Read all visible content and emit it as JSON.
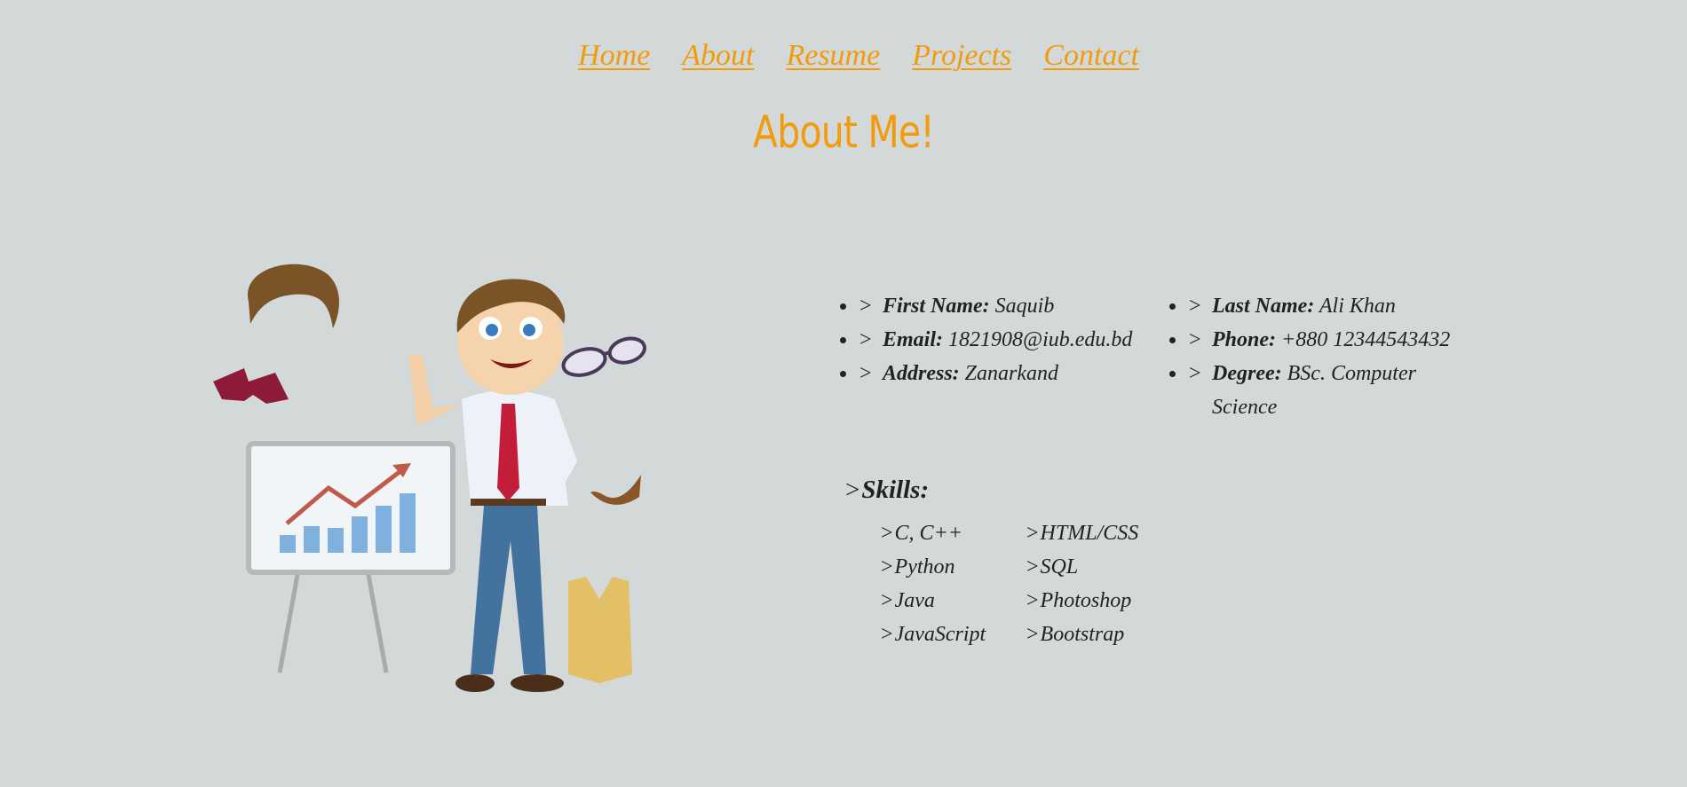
{
  "nav": {
    "items": [
      {
        "label": "Home"
      },
      {
        "label": "About"
      },
      {
        "label": "Resume"
      },
      {
        "label": "Projects"
      },
      {
        "label": "Contact"
      }
    ]
  },
  "page": {
    "title": "About Me!"
  },
  "info": {
    "first_name_label": "First Name:",
    "first_name": "Saquib",
    "email_label": "Email:",
    "email": "1821908@iub.edu.bd",
    "address_label": "Address:",
    "address": "Zanarkand",
    "last_name_label": "Last Name:",
    "last_name": "Ali Khan",
    "phone_label": "Phone:",
    "phone": "+880 12344543432",
    "degree_label": "Degree:",
    "degree": "BSc. Computer Science"
  },
  "skills": {
    "title": "Skills:",
    "col1": [
      "C, C++",
      "Python",
      "Java",
      "JavaScript"
    ],
    "col2": [
      "HTML/CSS",
      "SQL",
      "Photoshop",
      "Bootstrap"
    ]
  },
  "colors": {
    "accent": "#f29b0d",
    "background": "#d3d8d8",
    "text": "#222222"
  },
  "chevron": ">"
}
